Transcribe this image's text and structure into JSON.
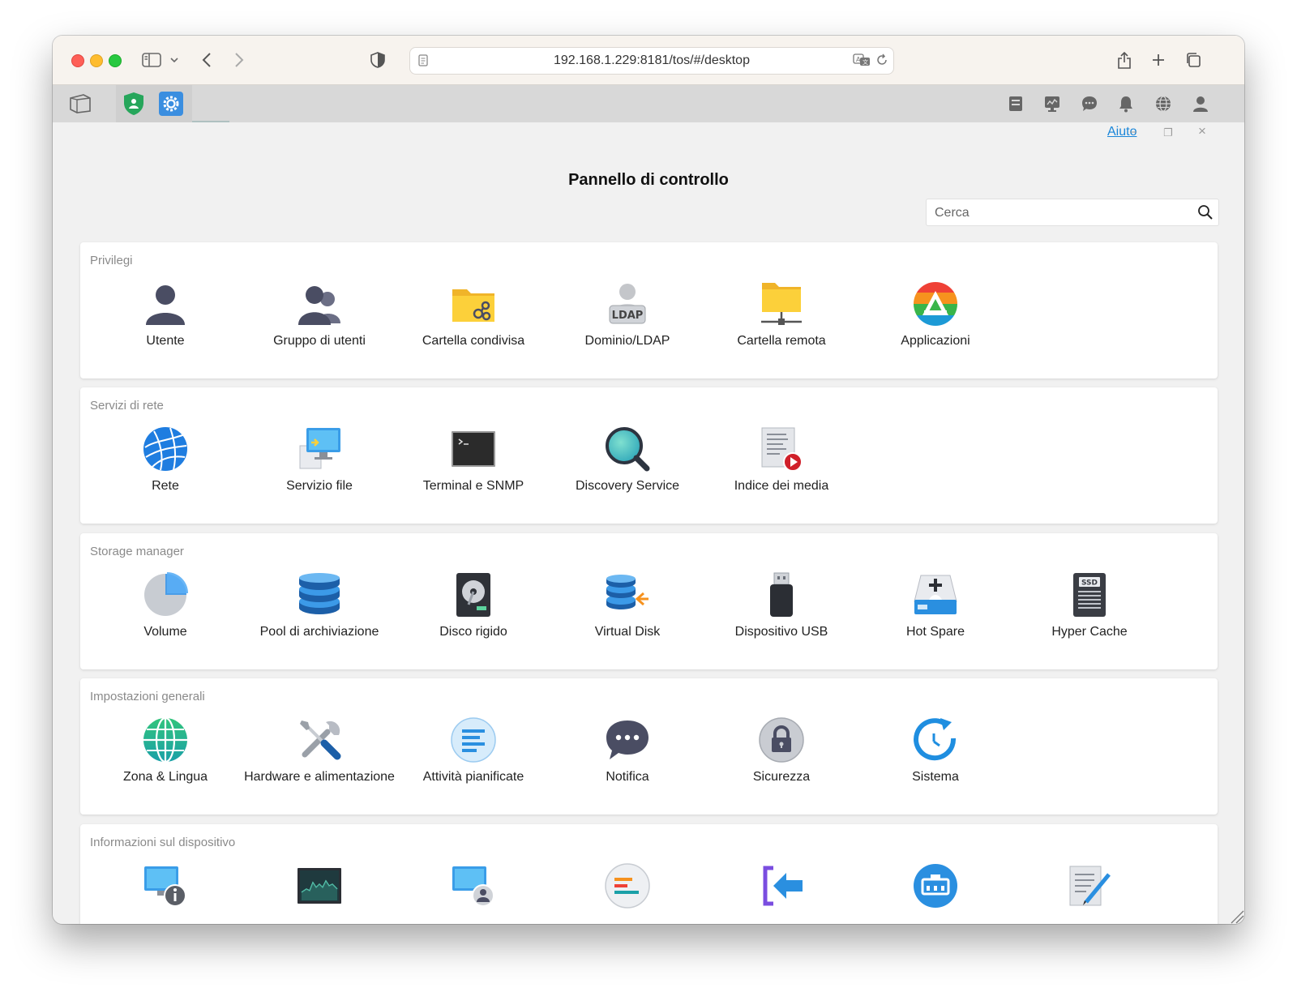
{
  "browser": {
    "url": "192.168.1.229:8181/tos/#/desktop"
  },
  "window": {
    "title": "Pannello di controllo",
    "help_label": "Aiuto",
    "minimize_glyph": "–",
    "restore_glyph": "❐",
    "close_glyph": "×"
  },
  "search": {
    "placeholder": "Cerca"
  },
  "sections": [
    {
      "title": "Privilegi",
      "items": [
        {
          "label": "Utente",
          "icon": "user-icon"
        },
        {
          "label": "Gruppo di utenti",
          "icon": "user-group-icon"
        },
        {
          "label": "Cartella condivisa",
          "icon": "shared-folder-icon"
        },
        {
          "label": "Dominio/LDAP",
          "icon": "ldap-icon",
          "badge": "LDAP"
        },
        {
          "label": "Cartella remota",
          "icon": "remote-folder-icon"
        },
        {
          "label": "Applicazioni",
          "icon": "applications-icon"
        }
      ]
    },
    {
      "title": "Servizi di rete",
      "items": [
        {
          "label": "Rete",
          "icon": "network-globe-icon"
        },
        {
          "label": "Servizio file",
          "icon": "file-service-icon"
        },
        {
          "label": "Terminal e SNMP",
          "icon": "terminal-icon"
        },
        {
          "label": "Discovery Service",
          "icon": "magnifier-icon"
        },
        {
          "label": "Indice dei media",
          "icon": "media-index-icon"
        }
      ]
    },
    {
      "title": "Storage manager",
      "items": [
        {
          "label": "Volume",
          "icon": "volume-pie-icon"
        },
        {
          "label": "Pool di archiviazione",
          "icon": "storage-pool-icon"
        },
        {
          "label": "Disco rigido",
          "icon": "hard-disk-icon"
        },
        {
          "label": "Virtual Disk",
          "icon": "virtual-disk-icon"
        },
        {
          "label": "Dispositivo USB",
          "icon": "usb-drive-icon"
        },
        {
          "label": "Hot Spare",
          "icon": "hot-spare-icon"
        },
        {
          "label": "Hyper Cache",
          "icon": "ssd-icon",
          "badge": "SSD"
        }
      ]
    },
    {
      "title": "Impostazioni generali",
      "items": [
        {
          "label": "Zona & Lingua",
          "icon": "globe-icon"
        },
        {
          "label": "Hardware e alimentazione",
          "icon": "tools-icon"
        },
        {
          "label": "Attività pianificate",
          "icon": "scheduled-tasks-icon"
        },
        {
          "label": "Notifica",
          "icon": "chat-bubble-icon"
        },
        {
          "label": "Sicurezza",
          "icon": "lock-icon"
        },
        {
          "label": "Sistema",
          "icon": "system-clock-icon"
        }
      ]
    },
    {
      "title": "Informazioni sul dispositivo",
      "items": [
        {
          "label": "",
          "icon": "device-info-icon"
        },
        {
          "label": "",
          "icon": "resource-monitor-icon"
        },
        {
          "label": "",
          "icon": "online-users-icon"
        },
        {
          "label": "",
          "icon": "logs-icon"
        },
        {
          "label": "",
          "icon": "import-arrow-icon"
        },
        {
          "label": "",
          "icon": "network-device-icon"
        },
        {
          "label": "",
          "icon": "edit-document-icon"
        }
      ]
    }
  ],
  "colors": {
    "accent": "#1a86d9",
    "folder": "#fcd03a",
    "user": "#4a4d63"
  }
}
